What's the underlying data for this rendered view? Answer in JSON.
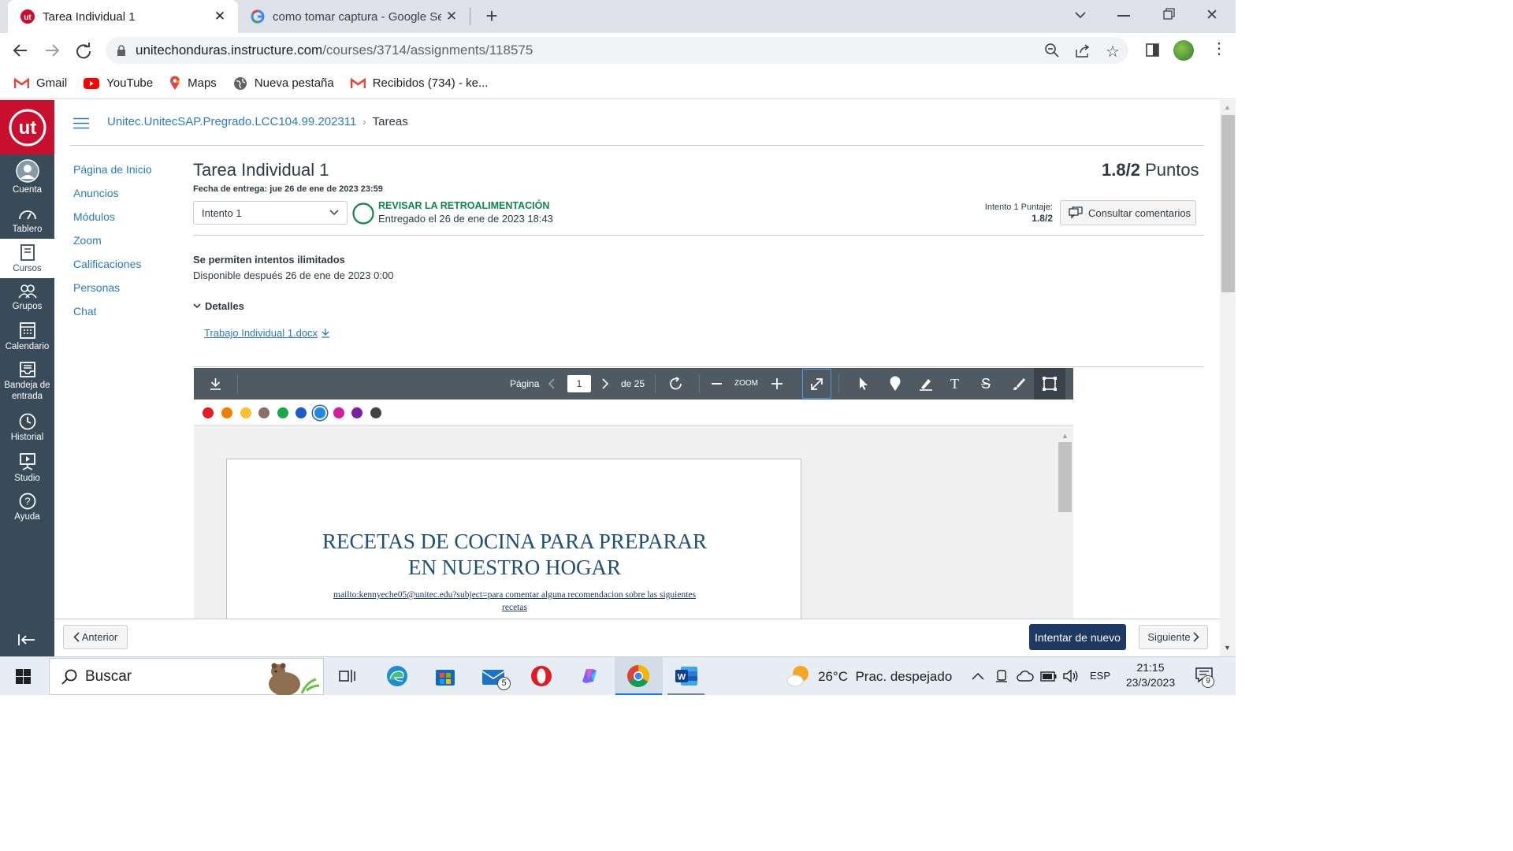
{
  "browser": {
    "tabs": [
      {
        "title": "Tarea Individual 1",
        "active": true
      },
      {
        "title": "como tomar captura - Google Se",
        "active": false
      }
    ],
    "url_host": "unitechonduras.instructure.com",
    "url_path": "/courses/3714/assignments/118575",
    "bookmarks": [
      "Gmail",
      "YouTube",
      "Maps",
      "Nueva pestaña",
      "Recibidos (734) - ke..."
    ]
  },
  "global_nav": {
    "brand_color": "#c8102e",
    "nav_color": "#394b58",
    "items": [
      {
        "label": "Cuenta",
        "icon": "avatar-icon"
      },
      {
        "label": "Tablero",
        "icon": "dashboard-icon"
      },
      {
        "label": "Cursos",
        "icon": "courses-icon",
        "selected": true
      },
      {
        "label": "Grupos",
        "icon": "groups-icon"
      },
      {
        "label": "Calendario",
        "icon": "calendar-icon"
      },
      {
        "label": "Bandeja de",
        "label2": "entrada",
        "icon": "inbox-icon"
      },
      {
        "label": "Historial",
        "icon": "history-icon"
      },
      {
        "label": "Studio",
        "icon": "studio-icon"
      },
      {
        "label": "Ayuda",
        "icon": "help-icon"
      }
    ]
  },
  "breadcrumb": {
    "course": "Unitec.UnitecSAP.Pregrado.LCC104.99.202311",
    "current": "Tareas"
  },
  "course_nav": [
    "Página de Inicio",
    "Anuncios",
    "Módulos",
    "Zoom",
    "Calificaciones",
    "Personas",
    "Chat"
  ],
  "assignment": {
    "title": "Tarea Individual 1",
    "points_value": "1.8/2",
    "points_word": "Puntos",
    "due_label": "Fecha de entrega:",
    "due_value": "jue 26 de ene de 2023 23:59",
    "attempt_select": "Intento 1",
    "status_title": "REVISAR LA RETROALIMENTACIÓN",
    "status_sub": "Entregado el 26 de ene de 2023 18:43",
    "attempt_score_label": "Intento 1 Puntaje:",
    "attempt_score": "1.8/2",
    "feedback_button": "Consultar comentarios",
    "attempts_info": "Se permiten intentos ilimitados",
    "available_info": "Disponible después 26 de ene de 2023 0:00",
    "details_label": "Detalles",
    "file_name": "Trabajo Individual 1.docx"
  },
  "pdf_toolbar": {
    "page_label": "Página",
    "page_value": "1",
    "page_total": "de 25",
    "zoom_label": "ZOOM",
    "colors": [
      "#e51c23",
      "#f57c00",
      "#fbc02d",
      "#8d6e63",
      "#1aa94a",
      "#1e5bc6",
      "#1e88e5",
      "#d81b9c",
      "#7b1fa2",
      "#424242"
    ],
    "selected_color": "#1e88e5"
  },
  "document": {
    "heading_line1": "RECETAS DE COCINA PARA PREPARAR",
    "heading_line2": "EN NUESTRO HOGAR",
    "link_line1": "mailto:kennyeche05@unitec.edu?subject=para comentar alguna recomendacion sobre las siguientes",
    "link_line2": "recetas",
    "heading_color": "#1f4e79"
  },
  "footer": {
    "prev": "Anterior",
    "retry": "Intentar de nuevo",
    "next": "Siguiente"
  },
  "taskbar": {
    "search": "Buscar",
    "mail_badge": "5",
    "weather_temp": "26°C",
    "weather_text": "Prac. despejado",
    "lang": "ESP",
    "time": "21:15",
    "date": "23/3/2023",
    "notif_badge": "9"
  }
}
